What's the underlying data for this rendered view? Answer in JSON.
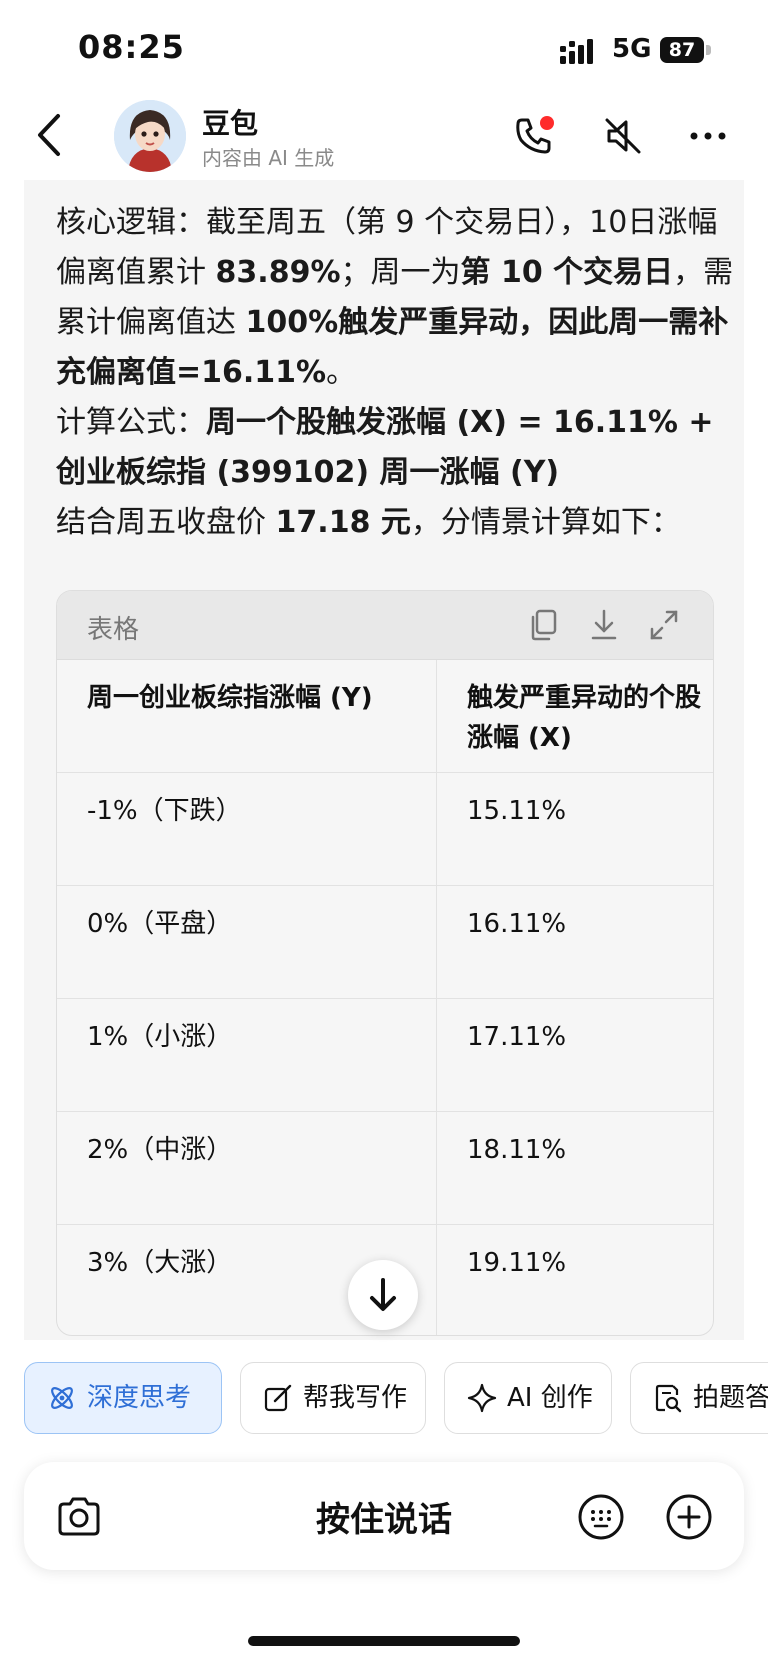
{
  "status_bar": {
    "time": "08:25",
    "network": "5G",
    "battery": "87"
  },
  "header": {
    "title": "豆包",
    "subtitle": "内容由 AI 生成"
  },
  "message": {
    "p1": [
      {
        "t": "核心逻辑：截至周五（第 9 个交易日），10日涨幅偏离值累计 ",
        "b": false
      },
      {
        "t": "83.89%",
        "b": true
      },
      {
        "t": "；周一为",
        "b": false
      },
      {
        "t": "第 10 个交易日",
        "b": true
      },
      {
        "t": "，需累计偏离值达 ",
        "b": false
      },
      {
        "t": "100%触发严重异动，因此周一需补充偏离值=16.11%",
        "b": true
      },
      {
        "t": "。",
        "b": false
      }
    ],
    "p2": [
      {
        "t": "计算公式：",
        "b": false
      },
      {
        "t": "周一个股触发涨幅 (X) = 16.11% + 创业板综指 (399102) 周一涨幅 (Y)",
        "b": true
      }
    ],
    "p3": [
      {
        "t": "结合周五收盘价 ",
        "b": false
      },
      {
        "t": "17.18 元",
        "b": true
      },
      {
        "t": "，分情景计算如下：",
        "b": false
      }
    ]
  },
  "table": {
    "label": "表格",
    "headers": [
      "周一创业板综指涨幅 (Y)",
      "触发严重异动的个股涨幅 (X)"
    ],
    "rows": [
      [
        "-1%（下跌）",
        "15.11%"
      ],
      [
        "0%（平盘）",
        "16.11%"
      ],
      [
        "1%（小涨）",
        "17.11%"
      ],
      [
        "2%（中涨）",
        "18.11%"
      ],
      [
        "3%（大涨）",
        "19.11%"
      ]
    ]
  },
  "quick_actions": [
    {
      "label": "深度思考",
      "icon": "atom-icon"
    },
    {
      "label": "帮我写作",
      "icon": "edit-icon"
    },
    {
      "label": "AI 创作",
      "icon": "sparkle-icon"
    },
    {
      "label": "拍题答疑",
      "icon": "scan-doc-icon"
    }
  ],
  "input_bar": {
    "push_to_talk": "按住说话"
  },
  "colors": {
    "accent": "#2f6fd6",
    "call_dot": "#ff2b2b",
    "bubble_bg": "#f5f5f5"
  }
}
